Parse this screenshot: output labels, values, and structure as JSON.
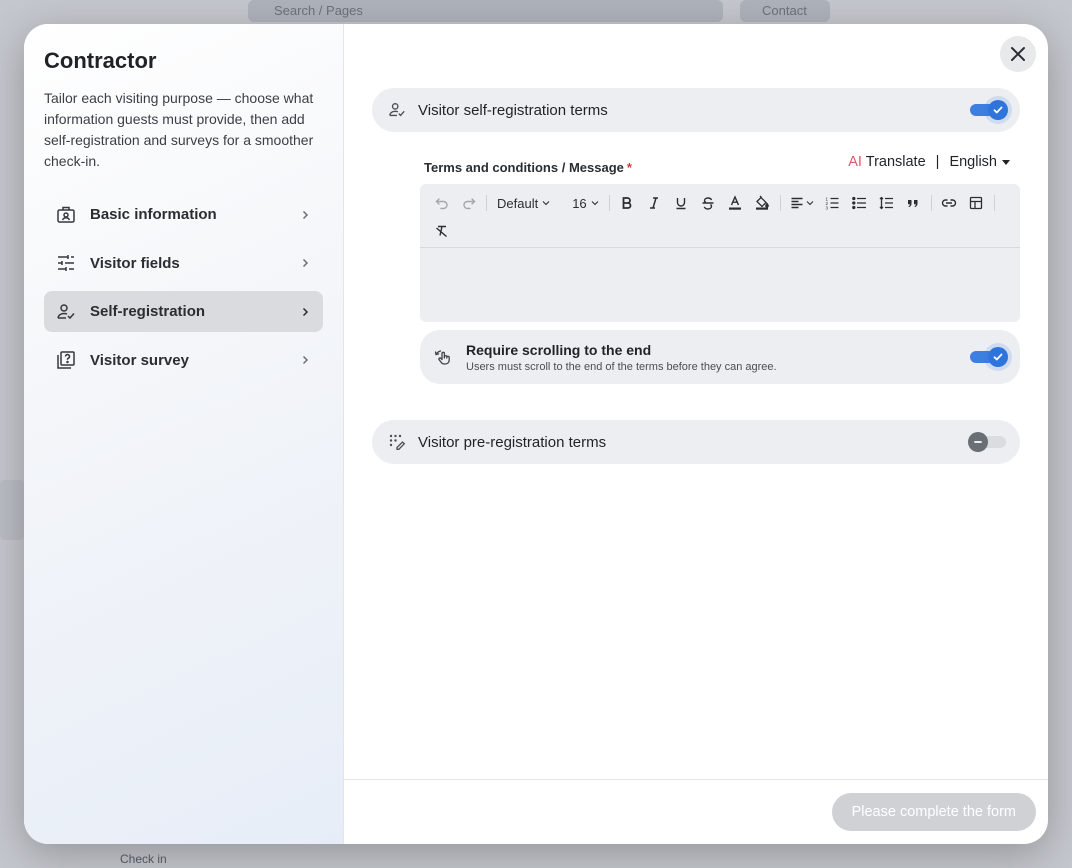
{
  "background": {
    "search_placeholder": "Search / Pages",
    "top_button": "Contact",
    "bottom_hint": "Check in"
  },
  "modal": {
    "title": "Contractor",
    "description": "Tailor each visiting purpose — choose what information guests must provide, then add self-registration and surveys for a smoother check-in.",
    "nav": [
      {
        "label": "Basic information",
        "icon": "id-badge-icon",
        "active": false
      },
      {
        "label": "Visitor fields",
        "icon": "sliders-icon",
        "active": false
      },
      {
        "label": "Self-registration",
        "icon": "person-check-icon",
        "active": true
      },
      {
        "label": "Visitor survey",
        "icon": "survey-icon",
        "active": false
      }
    ],
    "self_registration": {
      "label": "Visitor self-registration terms",
      "enabled": true,
      "field_label": "Terms and conditions / Message",
      "required_mark": "*",
      "ai_label": "AI",
      "translate_label": "Translate",
      "separator": "|",
      "language": "English",
      "toolbar": {
        "font_family": "Default",
        "font_size": "16"
      },
      "editor_content": "",
      "require_scroll": {
        "title": "Require scrolling to the end",
        "subtitle": "Users must scroll to the end of the terms before they can agree.",
        "enabled": true
      }
    },
    "pre_registration": {
      "label": "Visitor pre-registration terms",
      "enabled": false
    },
    "submit_label": "Please complete the form"
  },
  "colors": {
    "accent": "#2f74db",
    "ai": "#e2566a",
    "required": "#d43b3b",
    "disabled_button": "#cfd1d5"
  }
}
